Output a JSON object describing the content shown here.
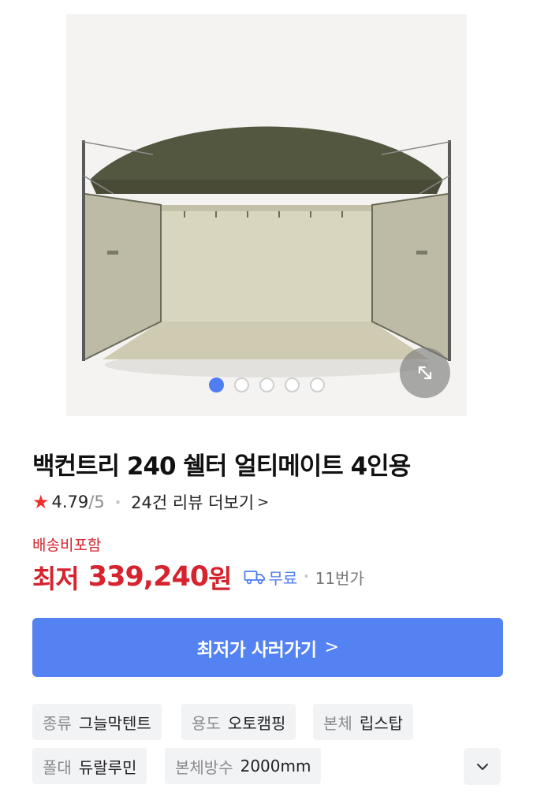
{
  "gallery": {
    "image_alt": "tent-photo",
    "slide_count": 5,
    "active_index": 0,
    "expand_icon": "expand-icon"
  },
  "product": {
    "title": "백컨트리 240 쉘터 얼티메이트 4인용",
    "rating": "4.79",
    "rating_max": "/5",
    "review_link": "24건 리뷰 더보기",
    "review_chevron": ">"
  },
  "price": {
    "shipping_note": "배송비포함",
    "label": "최저",
    "amount": "339,240",
    "currency": "원",
    "delivery": "무료",
    "seller": "11번가"
  },
  "cta": {
    "label": "최저가 사러가기",
    "chevron": ">"
  },
  "specs": [
    {
      "key": "종류",
      "value": "그늘막텐트"
    },
    {
      "key": "용도",
      "value": "오토캠핑"
    },
    {
      "key": "본체",
      "value": "립스탑"
    },
    {
      "key": "폴대",
      "value": "듀랄루민"
    },
    {
      "key": "본체방수",
      "value": "2000mm"
    }
  ],
  "colors": {
    "accent": "#5482f2",
    "price_red": "#d6232e",
    "star": "#f0322e",
    "tent_green": "#5c5f4a",
    "tent_inner": "#d9d6c0"
  }
}
